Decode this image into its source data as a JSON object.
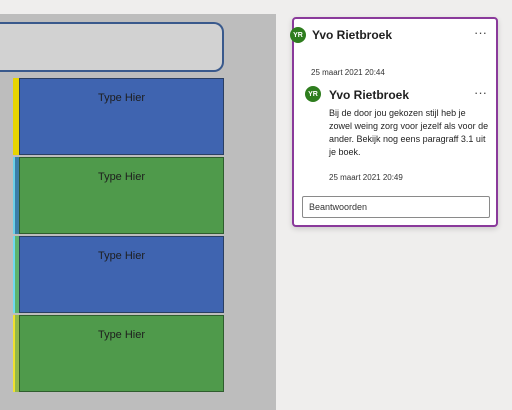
{
  "slide": {
    "shapes": [
      {
        "label": "Type Hier",
        "color": "#3f64b0"
      },
      {
        "label": "Type Hier",
        "color": "#4f9a4b"
      },
      {
        "label": "Type Hier",
        "color": "#3f64b0"
      },
      {
        "label": "Type Hier",
        "color": "#4f9a4b"
      }
    ]
  },
  "comment": {
    "thread_author_initials": "YR",
    "thread_author": "Yvo Rietbroek",
    "thread_timestamp": "25 maart 2021 20:44",
    "reply_author_initials": "YR",
    "reply_author": "Yvo Rietbroek",
    "reply_text": "Bij de door jou gekozen stijl heb je zowel weing zorg voor jezelf als voor de ander. Bekijk nog eens paragraff 3.1 uit je boek.",
    "reply_timestamp": "25 maart 2021 20:49",
    "more_label": "···",
    "reply_placeholder": "Beantwoorden",
    "accent_color": "#8a3a9b",
    "avatar_color": "#2e7d1e"
  }
}
